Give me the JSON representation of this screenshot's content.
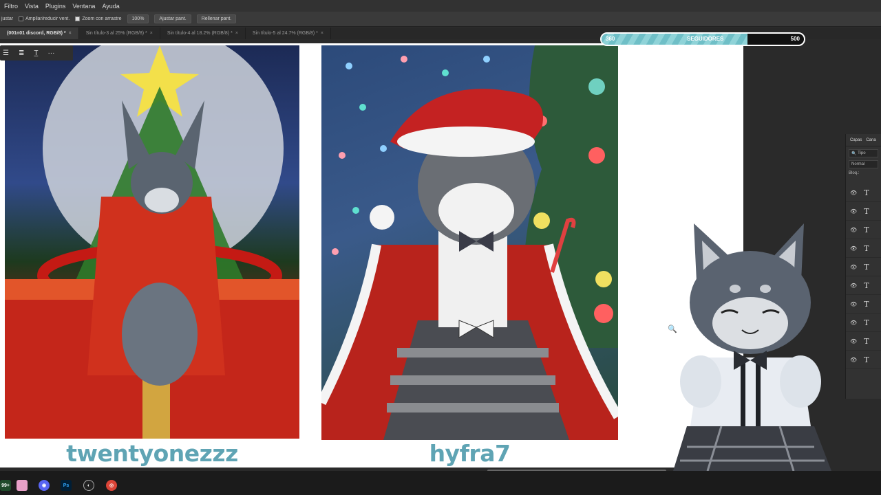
{
  "menu": [
    "Filtro",
    "Vista",
    "Plugins",
    "Ventana",
    "Ayuda"
  ],
  "options": {
    "tool_label": "justar",
    "resize_label": "Ampliar/reducir vent.",
    "resize_checked": false,
    "scrubby_label": "Zoom con arrastre",
    "scrubby_checked": true,
    "zoom_value": "100%",
    "fit_button": "Ajustar pant.",
    "fill_button": "Rellenar pant."
  },
  "tabs": [
    {
      "label": "(001n01 discord, RGB/8) *",
      "active": true
    },
    {
      "label": "Sin título-3 al 25% (RGB/8) *",
      "active": false
    },
    {
      "label": "Sin título-4 al 18.2% (RGB/8) *",
      "active": false
    },
    {
      "label": "Sin título-5 al 24.7% (RGB/8) *",
      "active": false
    }
  ],
  "tab_close": "×",
  "floattools": {
    "t_icon": "T̲",
    "more": "···"
  },
  "entries": [
    {
      "name": "twentyonezzz"
    },
    {
      "name": "hyfra7"
    }
  ],
  "followers": {
    "current": "360",
    "label": "SEGUIDORES",
    "goal": "500",
    "fraction": 0.72,
    "fill_color": "#7cc8cf"
  },
  "layers_panel": {
    "tab_layers": "Capas",
    "tab_channels": "Cana",
    "filter_label": "Tipo",
    "blend_mode": "Normal",
    "lock_label": "Bloq.:",
    "rows": 10,
    "eye_glyph": "👁",
    "t_glyph": "T"
  },
  "colors": {
    "accent_teal": "#5fa4b4",
    "panel_dark": "#323232"
  },
  "taskbar_icons": [
    "badge-icon",
    "pink-app-icon",
    "discord-icon",
    "photoshop-icon",
    "obs-icon",
    "chrome-icon"
  ],
  "taskbar_labels": {
    "badge": "99+",
    "ps": "Ps"
  }
}
